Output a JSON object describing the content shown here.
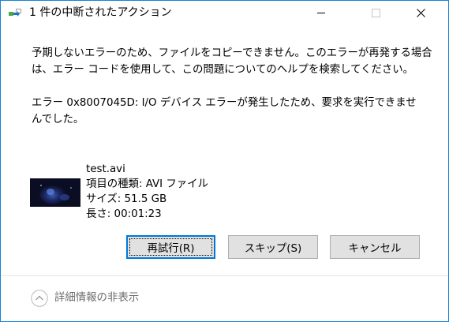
{
  "window": {
    "title": "1 件の中断されたアクション",
    "accent_color": "#1883d7"
  },
  "titlebar": {
    "icons": [
      "file-transfer-icon",
      "minimize-icon",
      "maximize-icon",
      "close-icon"
    ]
  },
  "message": "予期しないエラーのため、ファイルをコピーできません。このエラーが再発する場合は、エラー コードを使用して、この問題についてのヘルプを検索してください。",
  "error_message": "エラー 0x8007045D: I/O デバイス エラーが発生したため、要求を実行できませんでした。",
  "file": {
    "name": "test.avi",
    "type_line": "項目の種類: AVI ファイル",
    "size_line": "サイズ: 51.5 GB",
    "length_line": "長さ: 00:01:23"
  },
  "buttons": {
    "retry_label": "再試行(R)",
    "skip_label": "スキップ(S)",
    "cancel_label": "キャンセル"
  },
  "footer": {
    "toggle_label": "詳細情報の非表示",
    "toggle_icon": "chevron-up-icon"
  }
}
